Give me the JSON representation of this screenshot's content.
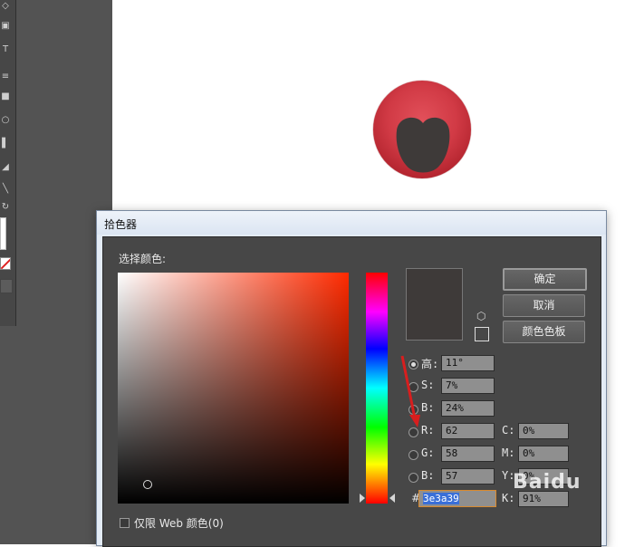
{
  "dialog": {
    "title": "拾色器",
    "select_color_label": "选择颜色:",
    "buttons": {
      "ok": "确定",
      "cancel": "取消",
      "swatches": "颜色色板"
    },
    "fields": {
      "hsb": [
        {
          "label": "高:",
          "value": "11°",
          "selected": true
        },
        {
          "label": "S:",
          "value": "7%",
          "selected": false
        },
        {
          "label": "B:",
          "value": "24%",
          "selected": false
        }
      ],
      "rgb": [
        {
          "label": "R:",
          "value": "62"
        },
        {
          "label": "G:",
          "value": "58"
        },
        {
          "label": "B:",
          "value": "57"
        }
      ],
      "cmyk": [
        {
          "label": "C:",
          "value": "0%"
        },
        {
          "label": "M:",
          "value": "0%"
        },
        {
          "label": "Y:",
          "value": "0%"
        },
        {
          "label": "K:",
          "value": "91%"
        }
      ],
      "hex": {
        "prefix": "#",
        "value": "3e3a39"
      }
    },
    "web_only_label": "仅限 Web 颜色(0)",
    "current_color": "#3e3a39"
  },
  "colors": {
    "accent_red": "#d13a45",
    "arrow_red": "#d81e1e",
    "hex_selection": "#3a6fd8"
  },
  "watermark": "Baidu"
}
